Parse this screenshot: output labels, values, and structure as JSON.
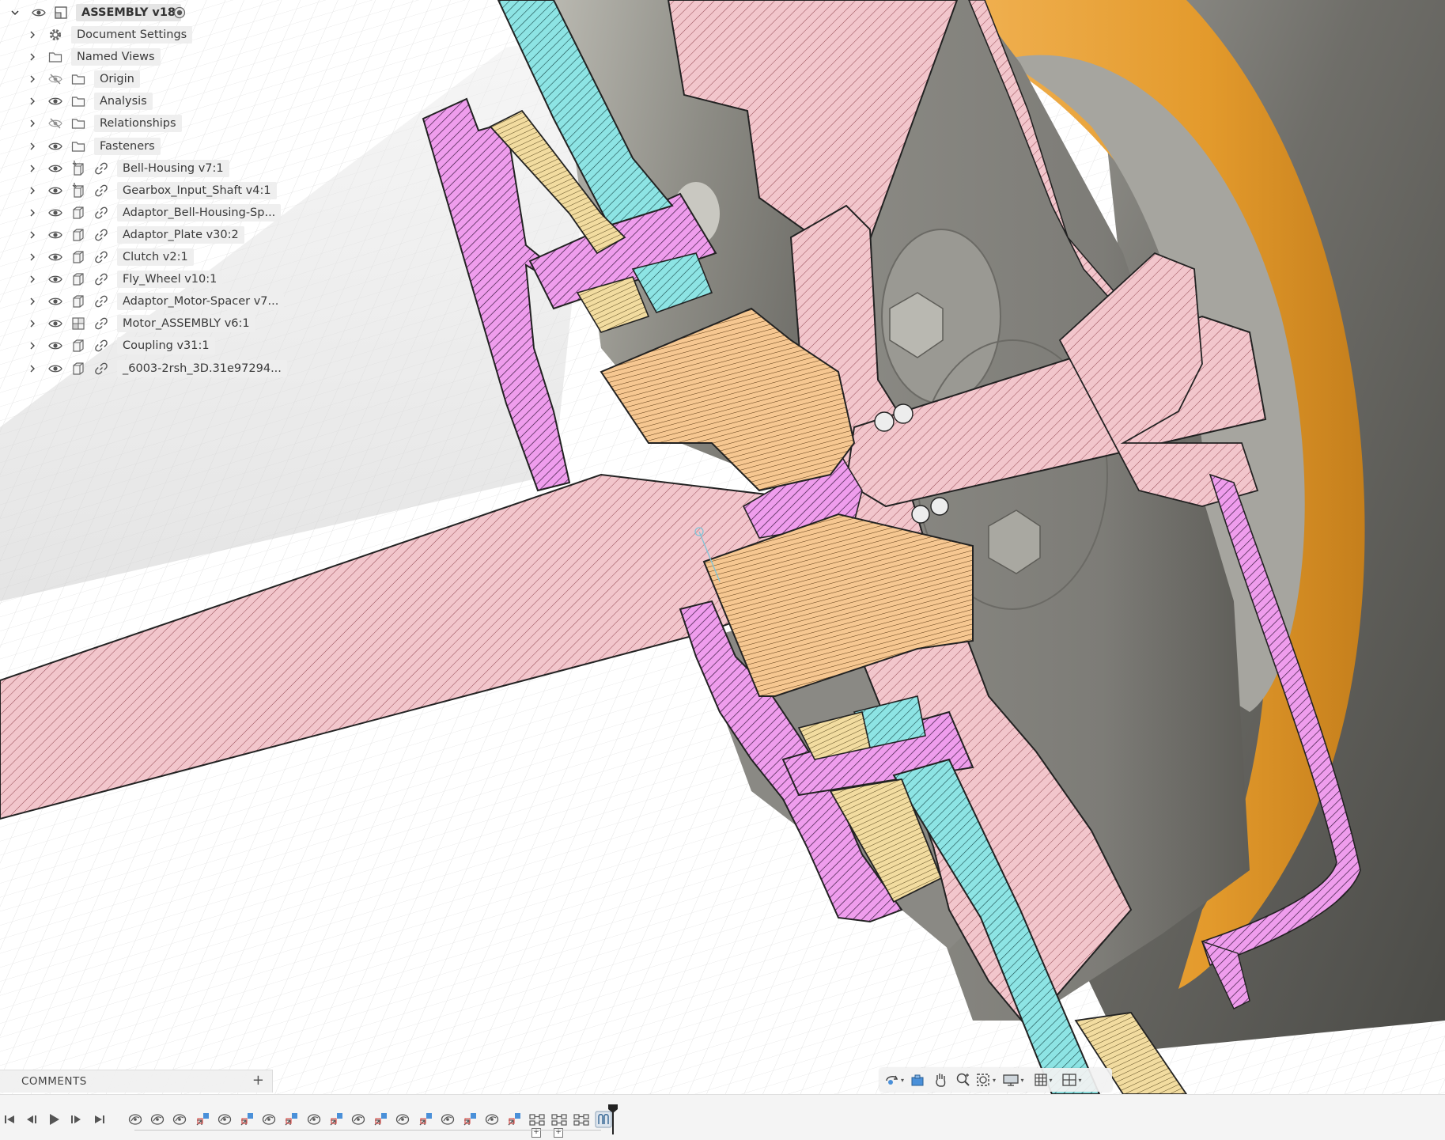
{
  "browser": {
    "root": {
      "label": "ASSEMBLY v18"
    },
    "items": [
      {
        "label": "Document Settings",
        "kind": "settings",
        "visible": null,
        "icon": "gear-icon"
      },
      {
        "label": "Named Views",
        "kind": "folder",
        "visible": null,
        "icon": "folder-icon"
      },
      {
        "label": "Origin",
        "kind": "folder",
        "visible": false,
        "icon": "folder-icon"
      },
      {
        "label": "Analysis",
        "kind": "folder",
        "visible": true,
        "icon": "folder-icon"
      },
      {
        "label": "Relationships",
        "kind": "folder",
        "visible": false,
        "icon": "folder-icon"
      },
      {
        "label": "Fasteners",
        "kind": "folder",
        "visible": true,
        "icon": "folder-icon"
      },
      {
        "label": "Bell-Housing v7:1",
        "kind": "component",
        "visible": true,
        "icon": "grounded-component-icon",
        "linked": true
      },
      {
        "label": "Gearbox_Input_Shaft v4:1",
        "kind": "component",
        "visible": true,
        "icon": "grounded-component-icon",
        "linked": true
      },
      {
        "label": "Adaptor_Bell-Housing-Sp...",
        "kind": "component",
        "visible": true,
        "icon": "component-icon",
        "linked": true
      },
      {
        "label": "Adaptor_Plate v30:2",
        "kind": "component",
        "visible": true,
        "icon": "component-icon",
        "linked": true
      },
      {
        "label": "Clutch v2:1",
        "kind": "component",
        "visible": true,
        "icon": "component-icon",
        "linked": true
      },
      {
        "label": "Fly_Wheel v10:1",
        "kind": "component",
        "visible": true,
        "icon": "component-icon",
        "linked": true
      },
      {
        "label": "Adaptor_Motor-Spacer v7...",
        "kind": "component",
        "visible": true,
        "icon": "component-icon",
        "linked": true
      },
      {
        "label": "Motor_ASSEMBLY v6:1",
        "kind": "component",
        "visible": true,
        "icon": "assembly-icon",
        "linked": true
      },
      {
        "label": "Coupling v31:1",
        "kind": "component",
        "visible": true,
        "icon": "component-icon",
        "linked": true
      },
      {
        "label": "_6003-2rsh_3D.31e97294...",
        "kind": "component",
        "visible": true,
        "icon": "component-icon",
        "linked": true
      }
    ]
  },
  "comments": {
    "label": "COMMENTS",
    "add": "+"
  },
  "navbar": {
    "tools": [
      "orbit-icon",
      "look-at-icon",
      "pan-icon",
      "zoom-icon",
      "fit-icon",
      "display-settings-icon",
      "grid-icon",
      "viewports-icon"
    ]
  },
  "timeline": {
    "controls": [
      "go-to-start-icon",
      "step-back-icon",
      "play-icon",
      "step-forward-icon",
      "go-to-end-icon"
    ],
    "features": [
      "joint",
      "joint",
      "joint",
      "as-built-joint",
      "joint",
      "as-built-joint",
      "joint",
      "as-built-joint",
      "joint",
      "as-built-joint",
      "joint",
      "as-built-joint",
      "joint",
      "as-built-joint",
      "joint",
      "as-built-joint",
      "joint",
      "as-built-joint",
      "rigid-group",
      "rigid-group",
      "rigid-group",
      "motion-link"
    ]
  },
  "colors": {
    "pink_section": "#f2c6cc",
    "magenta_section": "#ef9ded",
    "cyan_section": "#8de4e4",
    "yellow_section": "#f2dca0",
    "orange_section": "#f6c791",
    "motor_orange": "#e8a23c",
    "metal_gray": "#8c8b85"
  }
}
